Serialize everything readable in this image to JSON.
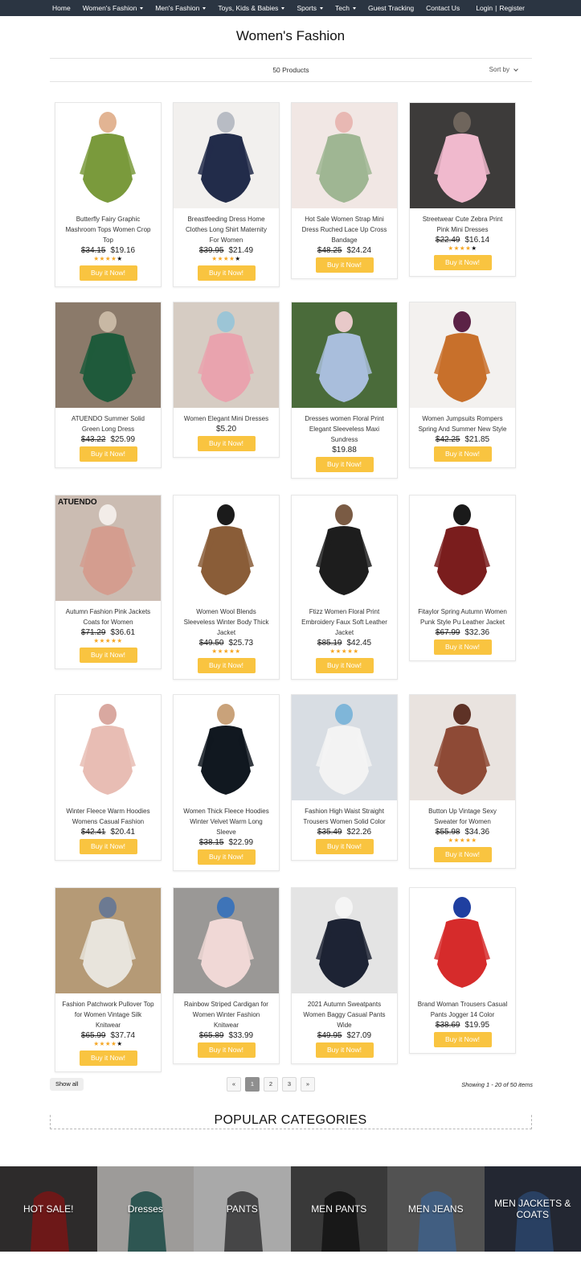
{
  "nav": {
    "items": [
      {
        "label": "Home",
        "dropdown": false
      },
      {
        "label": "Women's Fashion",
        "dropdown": true
      },
      {
        "label": "Men's Fashion",
        "dropdown": true
      },
      {
        "label": "Toys, Kids & Babies",
        "dropdown": true
      },
      {
        "label": "Sports",
        "dropdown": true
      },
      {
        "label": "Tech",
        "dropdown": true
      },
      {
        "label": "Guest Tracking",
        "dropdown": false
      },
      {
        "label": "Contact Us",
        "dropdown": false
      }
    ],
    "login": "Login",
    "separator": "|",
    "register": "Register"
  },
  "page": {
    "title": "Women's Fashion",
    "product_count": "50 Products",
    "sort_label": "Sort by"
  },
  "products": [
    {
      "name": "Butterfly Fairy Graphic Mashroom Tops Women Crop Top",
      "old_price": "$34.15",
      "price": "$19.16",
      "stars": 4,
      "buy": "Buy it Now!",
      "colors": [
        "#ffffff",
        "#7a9a3c",
        "#e2b493"
      ]
    },
    {
      "name": "Breastfeeding Dress Home Clothes Long Shirt Maternity For Women",
      "old_price": "$39.95",
      "price": "$21.49",
      "stars": 4,
      "buy": "Buy it Now!",
      "colors": [
        "#f2f0ee",
        "#222c4a",
        "#b8bcc4"
      ]
    },
    {
      "name": "Hot Sale Women Strap Mini Dress Ruched Lace Up Cross Bandage",
      "old_price": "$48.25",
      "price": "$24.24",
      "stars": 0,
      "buy": "Buy it Now!",
      "colors": [
        "#f1e7e4",
        "#9fb693",
        "#e8b8b3"
      ]
    },
    {
      "name": "Streetwear Cute Zebra Print Pink Mini Dresses",
      "old_price": "$22.49",
      "price": "$16.14",
      "stars": 4,
      "buy": "Buy it Now!",
      "colors": [
        "#3d3b3a",
        "#f0b9cd",
        "#6f655c"
      ]
    },
    {
      "name": "ATUENDO Summer Solid Green Long Dress",
      "old_price": "$43.22",
      "price": "$25.99",
      "stars": 0,
      "buy": "Buy it Now!",
      "colors": [
        "#8b7a6a",
        "#1f5a3b",
        "#c8b8a4"
      ]
    },
    {
      "name": "Women Elegant Mini Dresses",
      "old_price": "",
      "price": "$5.20",
      "stars": 0,
      "buy": "Buy it Now!",
      "colors": [
        "#d6ccc3",
        "#e9a3ae",
        "#9cc5d6"
      ]
    },
    {
      "name": "Dresses women Floral Print Elegant Sleeveless Maxi Sundress",
      "old_price": "",
      "price": "$19.88",
      "stars": 0,
      "buy": "Buy it Now!",
      "colors": [
        "#4a6b3a",
        "#a9bedc",
        "#e8c9c9"
      ]
    },
    {
      "name": "Women Jumpsuits Rompers Spring And Summer New Style",
      "old_price": "$42.25",
      "price": "$21.85",
      "stars": 0,
      "buy": "Buy it Now!",
      "colors": [
        "#f3f1ef",
        "#c8702b",
        "#5b2246"
      ]
    },
    {
      "name": "Autumn Fashion Pink Jackets Coats for Women",
      "old_price": "$71.29",
      "price": "$36.61",
      "stars": 5,
      "buy": "Buy it Now!",
      "colors": [
        "#cbbcb2",
        "#d49d8f",
        "#f2ece8"
      ],
      "thumb_text": "ATUENDO"
    },
    {
      "name": "Women Wool Blends Sleeveless Winter Body Thick Jacket",
      "old_price": "$49.50",
      "price": "$25.73",
      "stars": 5,
      "buy": "Buy it Now!",
      "colors": [
        "#ffffff",
        "#8a5d38",
        "#1b1b1b"
      ]
    },
    {
      "name": "Ftizz Women Floral Print Embroidery Faux Soft Leather Jacket",
      "old_price": "$85.19",
      "price": "$42.45",
      "stars": 5,
      "buy": "Buy it Now!",
      "colors": [
        "#ffffff",
        "#1d1d1d",
        "#7a5b44"
      ]
    },
    {
      "name": "Fitaylor Spring Autumn Women Punk Style Pu Leather Jacket",
      "old_price": "$67.99",
      "price": "$32.36",
      "stars": 0,
      "buy": "Buy it Now!",
      "colors": [
        "#ffffff",
        "#7a1d1d",
        "#1a1a1a"
      ]
    },
    {
      "name": "Winter Fleece Warm Hoodies Womens Casual Fashion",
      "old_price": "$42.41",
      "price": "$20.41",
      "stars": 0,
      "buy": "Buy it Now!",
      "colors": [
        "#ffffff",
        "#e8bdb4",
        "#d9a8a0"
      ]
    },
    {
      "name": "Women Thick Fleece Hoodies Winter Velvet Warm Long Sleeve",
      "old_price": "$38.15",
      "price": "$22.99",
      "stars": 0,
      "buy": "Buy it Now!",
      "colors": [
        "#ffffff",
        "#111820",
        "#c9a27a"
      ]
    },
    {
      "name": "Fashion High Waist Straight Trousers Women Solid Color",
      "old_price": "$35.49",
      "price": "$22.26",
      "stars": 0,
      "buy": "Buy it Now!",
      "colors": [
        "#d8dde3",
        "#f3f3f3",
        "#7fb6d9"
      ]
    },
    {
      "name": "Button Up Vintage Sexy Sweater for Women",
      "old_price": "$55.98",
      "price": "$34.36",
      "stars": 5,
      "buy": "Buy it Now!",
      "colors": [
        "#e9e3df",
        "#8e4a36",
        "#5e3226"
      ]
    },
    {
      "name": "Fashion Patchwork Pullover Top for Women Vintage Silk Knitwear",
      "old_price": "$65.99",
      "price": "$37.74",
      "stars": 4,
      "buy": "Buy it Now!",
      "colors": [
        "#b59a76",
        "#e8e4dc",
        "#6c7a92"
      ]
    },
    {
      "name": "Rainbow Striped Cardigan for Women Winter Fashion Knitwear",
      "old_price": "$65.89",
      "price": "$33.99",
      "stars": 0,
      "buy": "Buy it Now!",
      "colors": [
        "#9a9896",
        "#f0d8d6",
        "#3e74b8"
      ]
    },
    {
      "name": "2021 Autumn Sweatpants Women Baggy Casual Pants Wide",
      "old_price": "$49.95",
      "price": "$27.09",
      "stars": 0,
      "buy": "Buy it Now!",
      "colors": [
        "#e4e4e4",
        "#1d2334",
        "#f5f5f5"
      ]
    },
    {
      "name": "Brand Woman Trousers Casual Pants Jogger 14 Color",
      "old_price": "$38.69",
      "price": "$19.95",
      "stars": 0,
      "buy": "Buy it Now!",
      "colors": [
        "#ffffff",
        "#d62b2b",
        "#1f3fa0"
      ]
    }
  ],
  "pagination": {
    "show_all": "Show all",
    "pages": [
      "«",
      "1",
      "2",
      "3",
      "»"
    ],
    "active_page": "1",
    "showing": "Showing 1 - 20 of 50 items"
  },
  "popular": {
    "title": "POPULAR CATEGORIES",
    "items": [
      {
        "label": "HOT SALE!",
        "colors": [
          "#3a3838",
          "#8c1f1f"
        ]
      },
      {
        "label": "Dresses",
        "colors": [
          "#c9c7c4",
          "#3c6f6a"
        ]
      },
      {
        "label": "PANTS",
        "colors": [
          "#d9d9d9",
          "#5a5a5c"
        ]
      },
      {
        "label": "MEN PANTS",
        "colors": [
          "#4a4a4a",
          "#1f1f1f"
        ]
      },
      {
        "label": "MEN JEANS",
        "colors": [
          "#6a6a6a",
          "#5479a6"
        ]
      },
      {
        "label": "MEN JACKETS & COATS",
        "colors": [
          "#2d3340",
          "#35527e"
        ]
      }
    ]
  }
}
